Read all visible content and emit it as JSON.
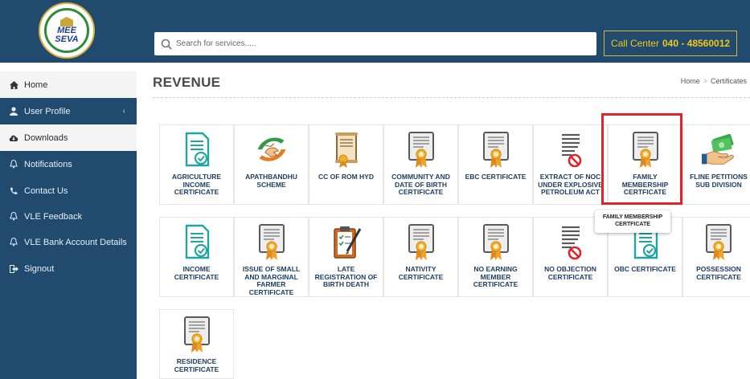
{
  "header": {
    "logo_text_1": "MEE",
    "logo_text_2": "SEVA",
    "search_placeholder": "Search for services.....",
    "call_label": "Call Center",
    "call_number": "040 - 48560012"
  },
  "sidebar": {
    "items": [
      {
        "label": "Home",
        "icon": "home-icon",
        "active": true
      },
      {
        "label": "User Profile",
        "icon": "user-icon",
        "active": false,
        "has_chevron": true
      },
      {
        "label": "Downloads",
        "icon": "cloud-download-icon",
        "active": true
      },
      {
        "label": "Notifications",
        "icon": "bell-icon",
        "active": false
      },
      {
        "label": "Contact Us",
        "icon": "phone-icon",
        "active": false
      },
      {
        "label": "VLE Feedback",
        "icon": "bell-icon",
        "active": false
      },
      {
        "label": "VLE Bank Account Details",
        "icon": "bell-icon",
        "active": false
      },
      {
        "label": "Signout",
        "icon": "signout-icon",
        "active": false
      }
    ],
    "chevron": "‹"
  },
  "page": {
    "title": "REVENUE",
    "breadcrumb": [
      "Home",
      "Certificates"
    ],
    "breadcrumb_sep": ">"
  },
  "services": [
    {
      "label": "AGRICULTURE INCOME CERTIFICATE",
      "icon": "document-teal-icon"
    },
    {
      "label": "APATHBANDHU SCHEME",
      "icon": "hands-icon"
    },
    {
      "label": "CC OF ROM HYD",
      "icon": "scroll-certificate-icon"
    },
    {
      "label": "COMMUNITY AND DATE OF BIRTH CERTIFICATE",
      "icon": "certificate-icon"
    },
    {
      "label": "EBC CERTIFICATE",
      "icon": "certificate-icon"
    },
    {
      "label": "EXTRACT OF NOC UNDER EXPLOSIVE PETROLEUM ACT",
      "icon": "noc-icon"
    },
    {
      "label": "FAMILY MEMBERSHIP CERTFICATE",
      "icon": "certificate-icon"
    },
    {
      "label": "FLINE PETITIONS SUB DIVISION",
      "icon": "money-hand-icon"
    },
    {
      "label": "INCOME CERTIFICATE",
      "icon": "document-teal-icon"
    },
    {
      "label": "ISSUE OF SMALL AND MARGINAL FARMER CERTIFICATE",
      "icon": "certificate-icon"
    },
    {
      "label": "LATE REGISTRATION OF BIRTH DEATH",
      "icon": "clipboard-pen-icon"
    },
    {
      "label": "NATIVITY CERTIFICATE",
      "icon": "certificate-icon"
    },
    {
      "label": "NO EARNING MEMBER CERTIFICATE",
      "icon": "certificate-icon"
    },
    {
      "label": "NO OBJECTION CERTIFICATE",
      "icon": "noc-icon"
    },
    {
      "label": "OBC CERTIFICATE",
      "icon": "document-teal-icon"
    },
    {
      "label": "POSSESSION CERTIFICATE",
      "icon": "certificate-icon"
    },
    {
      "label": "RESIDENCE CERTIFICATE",
      "icon": "certificate-icon"
    }
  ],
  "tooltip": {
    "text": "FAMILY MEMBERSHIP CERTFICATE"
  },
  "colors": {
    "nav_bg": "#204b6f",
    "accent_gold": "#f5c518",
    "label_blue": "#1e3f66",
    "highlight_red": "#e0242b",
    "teal": "#20a5a0"
  }
}
